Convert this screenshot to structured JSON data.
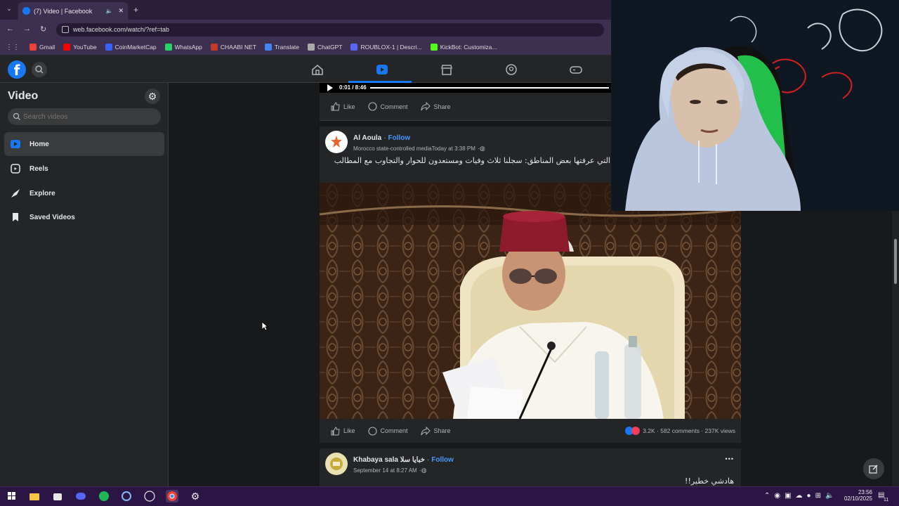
{
  "browser": {
    "tab_title": "(7) Video | Facebook",
    "url": "web.facebook.com/watch/?ref=tab",
    "bookmarks": [
      {
        "label": "Gmail",
        "color": "#ea4335"
      },
      {
        "label": "YouTube",
        "color": "#ff0000"
      },
      {
        "label": "CoinMarketCap",
        "color": "#3861fb"
      },
      {
        "label": "WhatsApp",
        "color": "#25d366"
      },
      {
        "label": "CHAABI NET",
        "color": "#c0392b"
      },
      {
        "label": "Translate",
        "color": "#4285f4"
      },
      {
        "label": "ChatGPT",
        "color": "#aaaaaa"
      },
      {
        "label": "ROUBLOX-1 | Descri...",
        "color": "#5865f2"
      },
      {
        "label": "KickBot: Customiza...",
        "color": "#53fc18"
      }
    ]
  },
  "sidebar": {
    "title": "Video",
    "search_placeholder": "Search videos",
    "items": [
      {
        "label": "Home",
        "icon": "video-home-icon",
        "active": true
      },
      {
        "label": "Reels",
        "icon": "reels-icon"
      },
      {
        "label": "Explore",
        "icon": "explore-icon"
      },
      {
        "label": "Saved Videos",
        "icon": "saved-icon"
      }
    ]
  },
  "top_player": {
    "time": "0:01 / 8:46",
    "progress": 0.002
  },
  "actions": {
    "like": "Like",
    "comment": "Comment",
    "share": "Share"
  },
  "post1": {
    "author": "Al Aoula",
    "follow": "Follow",
    "separator": "·",
    "subtitle": "Morocco state-controlled mediaToday at 3:38 PM",
    "caption": "التي عرفتها بعض المناطق: سجلنا ثلاث وفيات ومستعدون للحوار والتجاوب مع المطالب",
    "stats": "3.2K · 582 comments · 237K views"
  },
  "post2": {
    "author": "Khabaya sala خبايا سلا",
    "follow": "Follow",
    "separator": "·",
    "time": "September 14 at 8:27 AM",
    "caption": "هادشي خطير!!",
    "more": "•••"
  },
  "taskbar": {
    "time": "23:56",
    "date": "02/10/2025",
    "notif_count": "11"
  }
}
